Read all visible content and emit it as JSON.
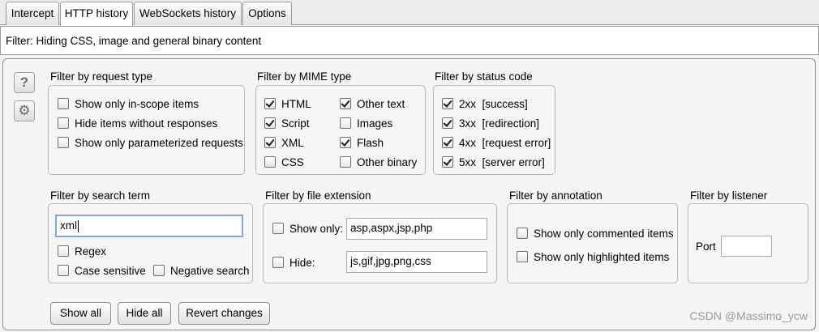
{
  "tabs": [
    "Intercept",
    "HTTP history",
    "WebSockets history",
    "Options"
  ],
  "filter_summary": "Filter: Hiding CSS, image and general binary content",
  "side_icons": {
    "help": "?",
    "settings": "⚙"
  },
  "request_type": {
    "title": "Filter by request type",
    "options": [
      {
        "label": "Show only in-scope items",
        "checked": false
      },
      {
        "label": "Hide items without responses",
        "checked": false
      },
      {
        "label": "Show only parameterized requests",
        "checked": false
      }
    ]
  },
  "mime_type": {
    "title": "Filter by MIME type",
    "options": [
      {
        "label": "HTML",
        "checked": true
      },
      {
        "label": "Script",
        "checked": true
      },
      {
        "label": "XML",
        "checked": true
      },
      {
        "label": "CSS",
        "checked": false
      },
      {
        "label": "Other text",
        "checked": true
      },
      {
        "label": "Images",
        "checked": false
      },
      {
        "label": "Flash",
        "checked": true
      },
      {
        "label": "Other binary",
        "checked": false
      }
    ]
  },
  "status_code": {
    "title": "Filter by status code",
    "options": [
      {
        "label": "2xx  [success]",
        "checked": true
      },
      {
        "label": "3xx  [redirection]",
        "checked": true
      },
      {
        "label": "4xx  [request error]",
        "checked": true
      },
      {
        "label": "5xx  [server error]",
        "checked": true
      }
    ]
  },
  "search_term": {
    "title": "Filter by search term",
    "value": "xml",
    "options": [
      {
        "label": "Regex",
        "checked": false
      },
      {
        "label": "Case sensitive",
        "checked": false
      },
      {
        "label": "Negative search",
        "checked": false
      }
    ]
  },
  "file_extension": {
    "title": "Filter by file extension",
    "show_only": {
      "label": "Show only:",
      "checked": false,
      "value": "asp,aspx,jsp,php"
    },
    "hide": {
      "label": "Hide:",
      "checked": false,
      "value": "js,gif,jpg,png,css"
    }
  },
  "annotation": {
    "title": "Filter by annotation",
    "options": [
      {
        "label": "Show only commented items",
        "checked": false
      },
      {
        "label": "Show only highlighted items",
        "checked": false
      }
    ]
  },
  "listener": {
    "title": "Filter by listener",
    "port_label": "Port",
    "port_value": ""
  },
  "buttons": {
    "show_all": "Show all",
    "hide_all": "Hide all",
    "revert": "Revert changes"
  },
  "watermark": "CSDN @Massimo_ycw"
}
